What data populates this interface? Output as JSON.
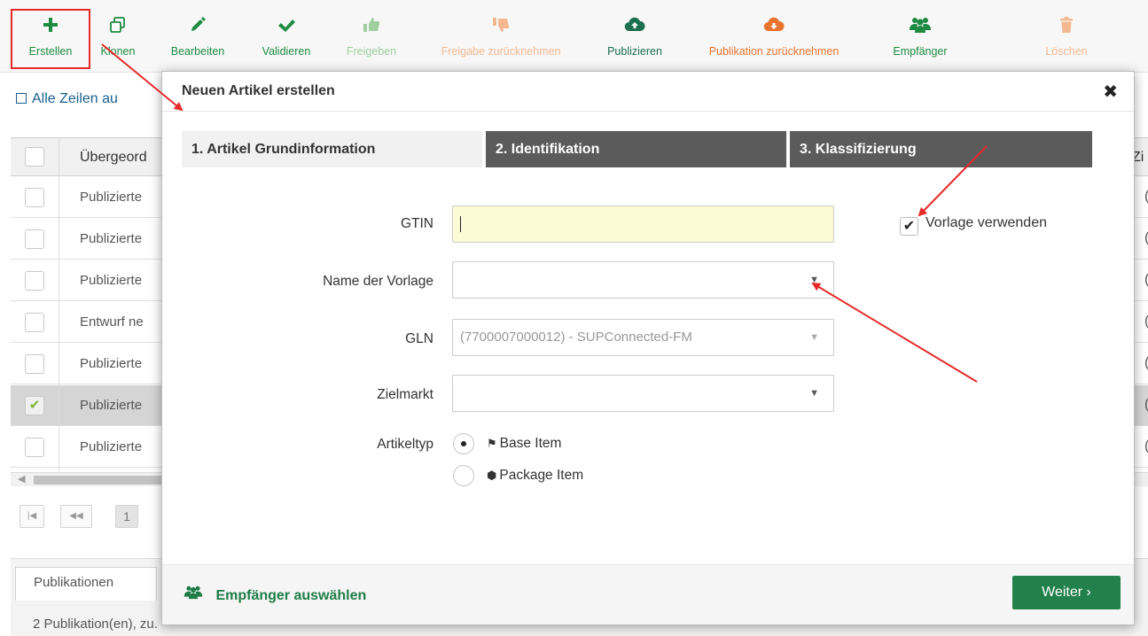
{
  "toolbar": {
    "create": "Erstellen",
    "clone": "Klonen",
    "edit": "Bearbeiten",
    "validate": "Validieren",
    "release": "Freigeben",
    "revoke_release": "Freigabe zurücknehmen",
    "publish": "Publizieren",
    "revoke_publication": "Publikation zurücknehmen",
    "recipients": "Empfänger",
    "delete": "Löschen"
  },
  "grid": {
    "select_all": "Alle Zeilen au",
    "header": "Übergeord",
    "header_right": "Zi",
    "rows": [
      {
        "text": "Publizierte",
        "checked": false
      },
      {
        "text": "Publizierte",
        "checked": false
      },
      {
        "text": "Publizierte",
        "checked": false
      },
      {
        "text": "Entwurf ne",
        "checked": false
      },
      {
        "text": "Publizierte",
        "checked": false
      },
      {
        "text": "Publizierte",
        "checked": true
      },
      {
        "text": "Publizierte",
        "checked": false
      }
    ],
    "row_paren": "(",
    "pager": {
      "first": "|◀",
      "prev": "◀◀",
      "page": "1"
    }
  },
  "bottom": {
    "tab": "Publikationen",
    "count": "2 Publikation(en), zu."
  },
  "modal": {
    "title": "Neuen Artikel erstellen",
    "close": "✖",
    "steps": [
      "1. Artikel Grundinformation",
      "2. Identifikation",
      "3. Klassifizierung"
    ],
    "fields": {
      "gtin_label": "GTIN",
      "gtin_value": "",
      "template_label": "Name der Vorlage",
      "template_value": "",
      "gln_label": "GLN",
      "gln_value": "(7700007000012) - SUPConnected-FM",
      "target_market_label": "Zielmarkt",
      "target_market_value": "",
      "item_type_label": "Artikeltyp",
      "item_type_options": [
        "Base Item",
        "Package Item"
      ],
      "item_type_selected": "Base Item"
    },
    "use_template": {
      "label": "Vorlage verwenden",
      "checked": true
    },
    "footer": {
      "recipients_link": "Empfänger auswählen",
      "next": "Weiter ›"
    }
  },
  "colors": {
    "accent_green": "#22814a",
    "step_inactive": "#5b5b5b",
    "annotation_red": "#e52a2a",
    "gtin_field_bg": "#fcfbd6"
  },
  "icons": {
    "create": "plus-icon",
    "clone": "clone-icon",
    "edit": "pencil-icon",
    "validate": "check-icon",
    "release": "thumbs-up-icon",
    "revoke_release": "thumbs-down-icon",
    "publish": "cloud-upload-icon",
    "revoke_publication": "cloud-download-icon",
    "recipients": "users-icon",
    "delete": "trash-icon"
  }
}
